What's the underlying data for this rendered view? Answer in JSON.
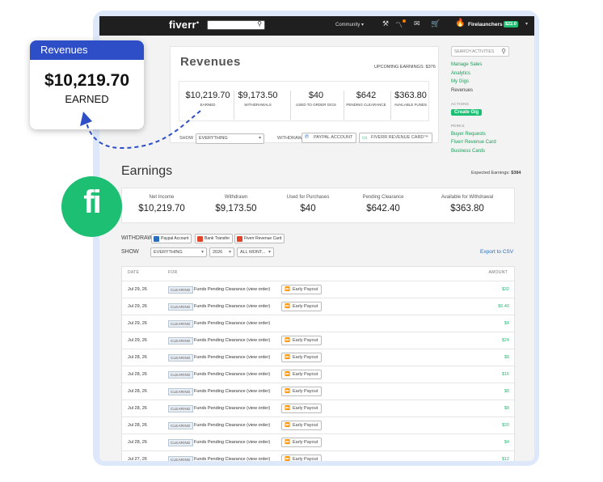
{
  "topbar": {
    "logo": "fiverr",
    "community": "Community",
    "user": "Firelaunchers",
    "balance": "$22.0"
  },
  "revenues": {
    "title": "Revenues",
    "upcoming": "UPCOMING EARNINGS: $376",
    "stats": [
      {
        "value": "$10,219.70",
        "label": "EARNED"
      },
      {
        "value": "$9,173.50",
        "label": "WITHDRAWALS"
      },
      {
        "value": "$40",
        "label": "USED TO ORDER GIGS"
      },
      {
        "value": "$642",
        "label": "PENDING CLEARANCE"
      },
      {
        "value": "$363.80",
        "label": "AVAILABLE FUNDS"
      }
    ],
    "show_label": "SHOW",
    "show_value": "EVERYTHING",
    "withdraw_label": "WITHDRAW",
    "paypal": "PAYPAL ACCOUNT",
    "revenue_card": "FIVERR REVENUE CARD™"
  },
  "sidebar": {
    "search_placeholder": "SEARCH ACTIVITIES",
    "links": [
      "Manage Sales",
      "Analytics",
      "My Gigs",
      "Revenues"
    ],
    "actions_heading": "ACTIONS",
    "create_gig": "Create Gig",
    "perks_heading": "PERKS",
    "perks": [
      "Buyer Requests",
      "Fiverr Revenue Card",
      "Business Cards"
    ]
  },
  "earnings": {
    "title": "Earnings",
    "expected_label": "Expected Earnings:",
    "expected_value": "$384",
    "stats": [
      {
        "label": "Net Income",
        "value": "$10,219.70"
      },
      {
        "label": "Withdrawn",
        "value": "$9,173.50"
      },
      {
        "label": "Used for Purchases",
        "value": "$40"
      },
      {
        "label": "Pending Clearance",
        "value": "$642.40"
      },
      {
        "label": "Available for Withdrawal",
        "value": "$363.80"
      }
    ],
    "withdraw_label": "WITHDRAW",
    "paypal": "Paypal Account",
    "bank": "Bank Transfer",
    "card": "Fiverr Revenue Card",
    "show_label": "SHOW",
    "filter_show": "EVERYTHING",
    "filter_year": "2026",
    "filter_month": "ALL MONT...",
    "export": "Export to CSV"
  },
  "table": {
    "headers": {
      "date": "DATE",
      "for": "FOR",
      "amount": "AMOUNT"
    },
    "badge": "CLEARING",
    "payout": "Early Payout",
    "rows": [
      {
        "date": "Jul 29, 26",
        "for": "Funds Pending Clearance (view order)",
        "payout": true,
        "amount": "$32"
      },
      {
        "date": "Jul 29, 26",
        "for": "Funds Pending Clearance (view order)",
        "payout": true,
        "amount": "$6.40"
      },
      {
        "date": "Jul 29, 26",
        "for": "Funds Pending Clearance (view order)",
        "payout": false,
        "amount": "$4"
      },
      {
        "date": "Jul 29, 26",
        "for": "Funds Pending Clearance (view order)",
        "payout": true,
        "amount": "$24"
      },
      {
        "date": "Jul 28, 26",
        "for": "Funds Pending Clearance (view order)",
        "payout": true,
        "amount": "$8"
      },
      {
        "date": "Jul 28, 26",
        "for": "Funds Pending Clearance (view order)",
        "payout": true,
        "amount": "$16"
      },
      {
        "date": "Jul 28, 26",
        "for": "Funds Pending Clearance (view order)",
        "payout": true,
        "amount": "$8"
      },
      {
        "date": "Jul 28, 26",
        "for": "Funds Pending Clearance (view order)",
        "payout": true,
        "amount": "$8"
      },
      {
        "date": "Jul 28, 26",
        "for": "Funds Pending Clearance (view order)",
        "payout": true,
        "amount": "$20"
      },
      {
        "date": "Jul 28, 26",
        "for": "Funds Pending Clearance (view order)",
        "payout": true,
        "amount": "$4"
      },
      {
        "date": "Jul 27, 26",
        "for": "Funds Pending Clearance (view order)",
        "payout": true,
        "amount": "$12"
      }
    ]
  },
  "callout": {
    "title": "Revenues",
    "amount": "$10,219.70",
    "label": "EARNED"
  },
  "badge_logo": "fi"
}
